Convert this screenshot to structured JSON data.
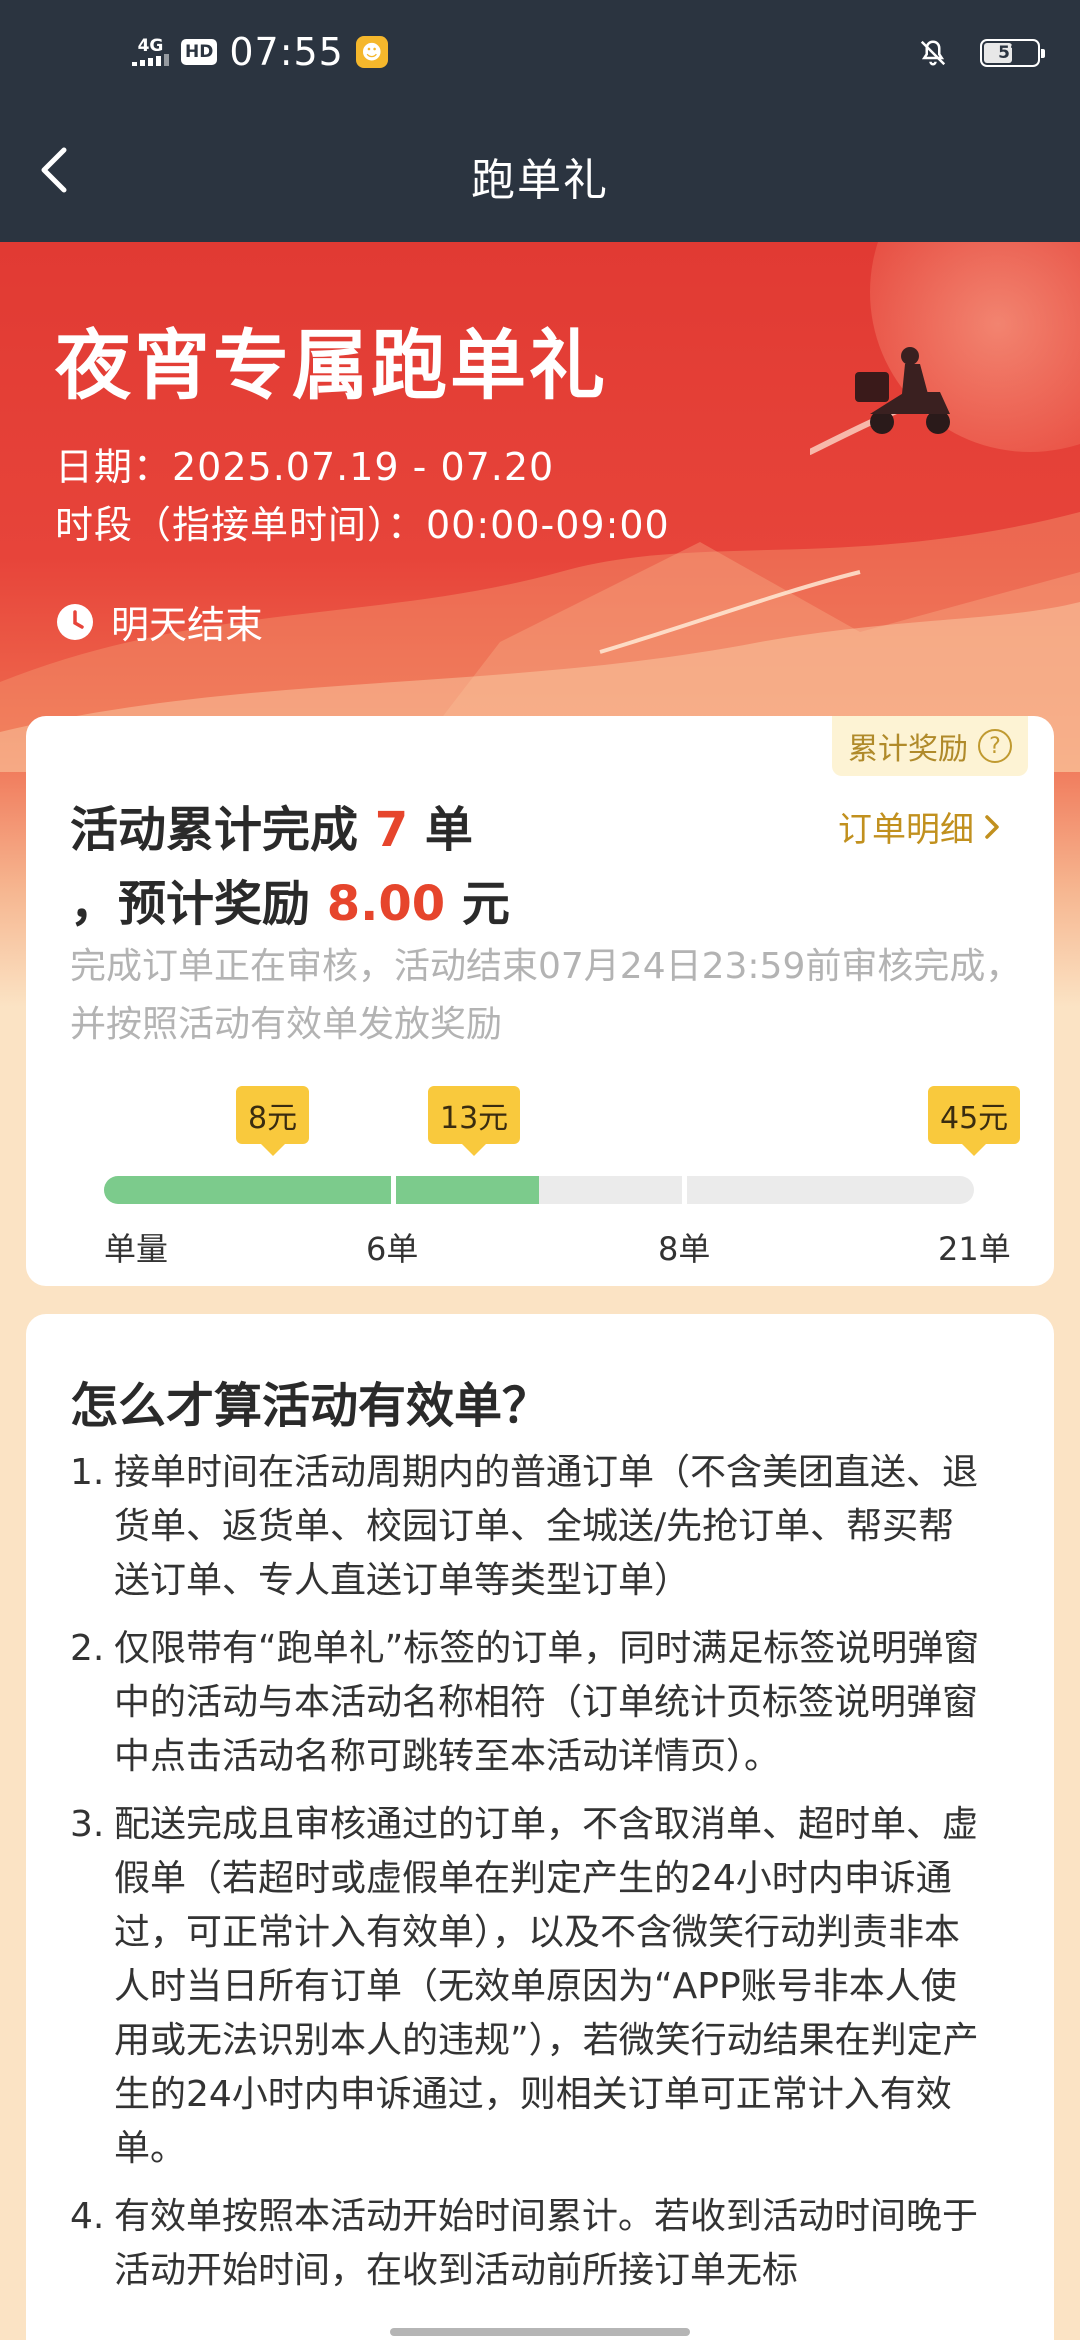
{
  "status_bar": {
    "network": "4G",
    "hd": "HD",
    "time": "07:55",
    "battery": "57",
    "battery_fraction": 0.57
  },
  "nav": {
    "title": "跑单礼"
  },
  "hero": {
    "title": "夜宵专属跑单礼",
    "date": "日期：2025.07.19 - 07.20",
    "period": "时段（指接单时间）：00:00-09:00",
    "end_text": "明天结束"
  },
  "progress_card": {
    "reward_tag": "累计奖励",
    "detail_link": "订单明细",
    "summary_prefix": "活动累计完成",
    "completed_count": "7",
    "count_unit": "单",
    "reward_prefix": "，预计奖励",
    "reward_amount": "8.00",
    "reward_unit": "元",
    "review_note": "完成订单正在审核，活动结束07月24日23:59前审核完成，并按照活动有效单发放奖励",
    "milestones": [
      {
        "orders": 6,
        "label": "6单",
        "reward": "8元"
      },
      {
        "orders": 8,
        "label": "8单",
        "reward": "13元"
      },
      {
        "orders": 21,
        "label": "21单",
        "reward": "45元"
      }
    ],
    "axis_start_label": "单量",
    "progress_fraction": 0.5
  },
  "rules": {
    "title": "怎么才算活动有效单？",
    "items": [
      {
        "num": "1.",
        "text": "接单时间在活动周期内的普通订单（不含美团直送、退货单、返货单、校园订单、全城送/先抢订单、帮买帮送订单、专人直送订单等类型订单）"
      },
      {
        "num": "2.",
        "text": "仅限带有“跑单礼”标签的订单，同时满足标签说明弹窗中的活动与本活动名称相符（订单统计页标签说明弹窗中点击活动名称可跳转至本活动详情页）。"
      },
      {
        "num": "3.",
        "text": "配送完成且审核通过的订单，不含取消单、超时单、虚假单（若超时或虚假单在判定产生的24小时内申诉通过，可正常计入有效单），以及不含微笑行动判责非本人时当日所有订单（无效单原因为“APP账号非本人使用或无法识别本人的违规”），若微笑行动结果在判定产生的24小时内申诉通过，则相关订单可正常计入有效单。"
      },
      {
        "num": "4.",
        "text": "有效单按照本活动开始时间累计。若收到活动时间晚于活动开始时间，在收到活动前所接订单无标"
      }
    ]
  },
  "colors": {
    "header_bg": "#2b3440",
    "hero_red": "#e13a33",
    "accent_orange": "#e6452c",
    "progress_green": "#7ccb8c",
    "milestone_yellow": "#f9c93d",
    "link_gold": "#c1901e"
  }
}
